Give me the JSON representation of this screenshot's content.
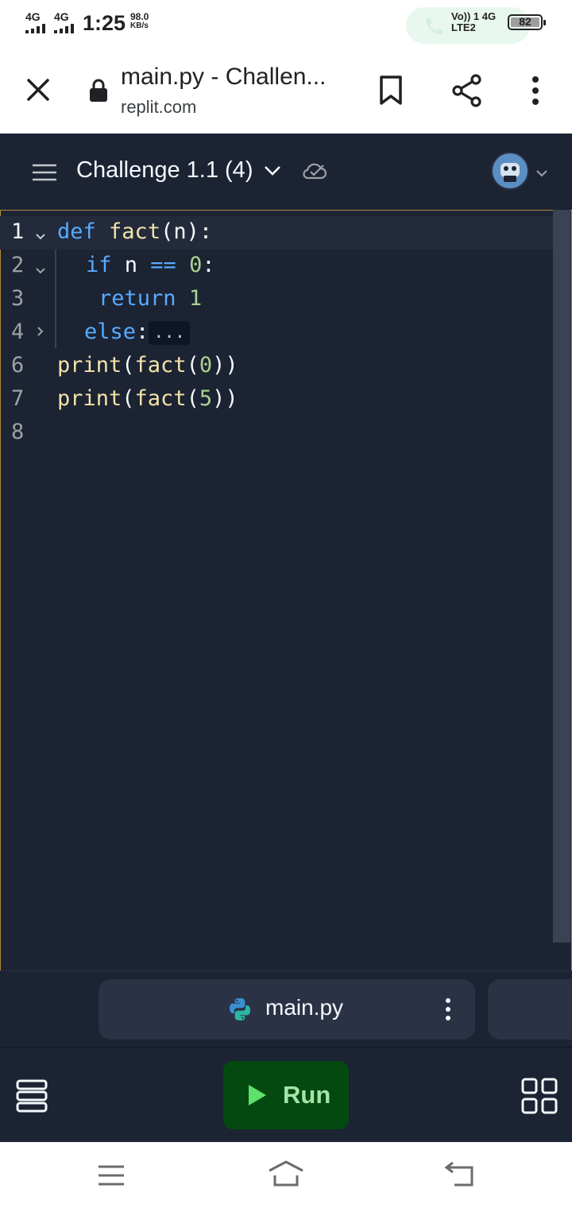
{
  "status_bar": {
    "network1": "4G",
    "network2": "4G",
    "time": "1:25",
    "speed_value": "98.0",
    "speed_unit": "KB/s",
    "volte_line1": "Vo)) 1 4G",
    "volte_line2": "LTE2",
    "battery": "82"
  },
  "browser": {
    "page_title": "main.py - Challen...",
    "url": "replit.com",
    "icons": [
      "close-icon",
      "lock-icon",
      "bookmark-icon",
      "share-icon",
      "more-vert-icon"
    ]
  },
  "repl_header": {
    "repl_name": "Challenge 1.1 (4)",
    "icons": [
      "hamburger-menu-icon",
      "chevron-down-icon",
      "cloud-check-icon",
      "avatar",
      "chevron-down-icon"
    ]
  },
  "editor": {
    "line_numbers": [
      "1",
      "2",
      "3",
      "4",
      "6",
      "7",
      "8"
    ],
    "lines": {
      "l1_kw": "def",
      "l1_fn": "fact",
      "l1_rest": "(n):",
      "l2_kw": "if",
      "l2_mid": " n ",
      "l2_op": "==",
      "l2_sp": " ",
      "l2_num": "0",
      "l2_end": ":",
      "l3_kw": "return",
      "l3_sp": " ",
      "l3_num": "1",
      "l4_kw": "else",
      "l4_colon": ":",
      "l4_fold": "...",
      "l6_fn": "print",
      "l6_p1": "(",
      "l6_fn2": "fact",
      "l6_p2": "(",
      "l6_num": "0",
      "l6_end": "))",
      "l7_fn": "print",
      "l7_p1": "(",
      "l7_fn2": "fact",
      "l7_p2": "(",
      "l7_num": "5",
      "l7_end": "))"
    }
  },
  "file_tabs": {
    "active_tab": "main.py"
  },
  "action_bar": {
    "run_label": "Run"
  },
  "colors": {
    "editor_bg": "#1c2333",
    "keyword": "#57abff",
    "function": "#f2e3a8",
    "number": "#a8d38f",
    "run_button": "#044a10",
    "run_text": "#a3e4a9"
  }
}
